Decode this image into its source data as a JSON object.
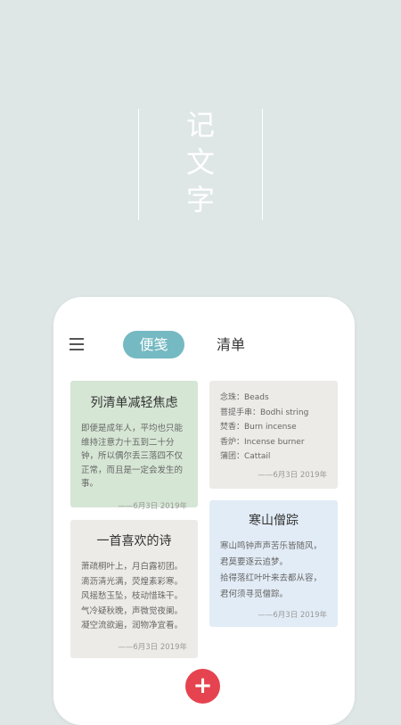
{
  "hero": {
    "chars": [
      "记",
      "文",
      "字"
    ]
  },
  "tabs": {
    "notes": "便笺",
    "list": "清单"
  },
  "notes": [
    {
      "title": "列清单减轻焦虑",
      "body": "即便是成年人，平均也只能维持注意力十五到二十分钟，所以偶尔丢三落四不仅正常，而且是一定会发生的事。",
      "date": "——6月3日 2019年"
    },
    {
      "lines": [
        "念珠：Beads",
        "菩提手串：Bodhi string",
        "焚香：Burn incense",
        "香炉：Incense burner",
        "蒲团：Cattail"
      ],
      "date": "——6月3日 2019年"
    },
    {
      "title": "一首喜欢的诗",
      "lines": [
        "萧疏桐叶上，月白露初团。",
        "滴沥清光满，荧煌素彩寒。",
        "风摇愁玉坠，枝动惜珠干。",
        "气冷疑秋晚，声微觉夜阑。",
        "凝空流欲遍，润物净宜看。"
      ],
      "date": "——6月3日 2019年"
    },
    {
      "title": "寒山僧踪",
      "lines": [
        "寒山鸣钟声声苦乐皆随风，",
        "君莫要逐云追梦。",
        "拾得落红叶叶来去都从容，",
        "君何须寻觅僧踪。"
      ],
      "date": "——6月3日 2019年"
    }
  ],
  "fab": {
    "label": "+"
  },
  "colors": {
    "background": "#dfe6e6",
    "accent": "#75b9c2",
    "fab": "#e5434f",
    "note_green": "#d5e6d4",
    "note_gray": "#ecebe7",
    "note_blue": "#e2ecf6"
  }
}
